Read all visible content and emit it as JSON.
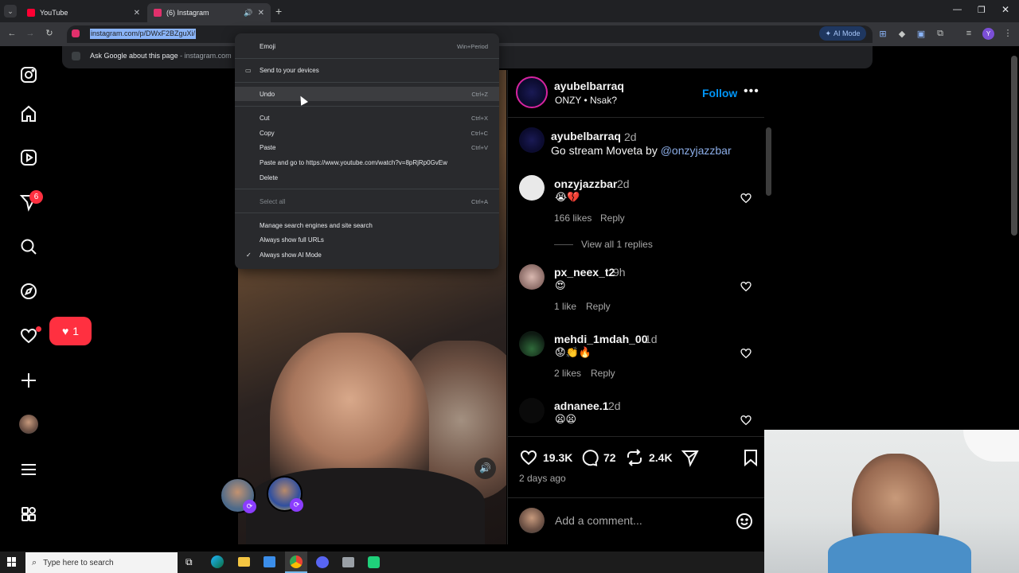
{
  "tabs": [
    {
      "title": "YouTube",
      "favicon_color": "#ff0033"
    },
    {
      "title": "(6) Instagram",
      "favicon_color": "#e1306c"
    }
  ],
  "omnibox": {
    "url": "instagram.com/p/DWxF2BZguXi/",
    "suggestion_text": "Ask Google about this page",
    "suggestion_domain": "- instagram.com"
  },
  "toolbar": {
    "ai_mode_label": "AI Mode",
    "profile_letter": "Y"
  },
  "context_menu": {
    "items": [
      {
        "label": "Emoji",
        "shortcut": "Win+Period"
      },
      {
        "label": "Send to your devices",
        "shortcut": ""
      },
      {
        "label": "Undo",
        "shortcut": "Ctrl+Z"
      },
      {
        "label": "Cut",
        "shortcut": "Ctrl+X"
      },
      {
        "label": "Copy",
        "shortcut": "Ctrl+C"
      },
      {
        "label": "Paste",
        "shortcut": "Ctrl+V"
      },
      {
        "label": "Paste and go to https://www.youtube.com/watch?v=8pRjRp0GvEw",
        "shortcut": ""
      },
      {
        "label": "Delete",
        "shortcut": ""
      },
      {
        "label": "Select all",
        "shortcut": "Ctrl+A"
      },
      {
        "label": "Manage search engines and site search",
        "shortcut": ""
      },
      {
        "label": "Always show full URLs",
        "shortcut": ""
      },
      {
        "label": "Always show AI Mode",
        "shortcut": ""
      }
    ],
    "checkmark": "✓"
  },
  "sidebar": {
    "notification_badge": "6",
    "likes_popup_count": "1"
  },
  "post": {
    "author": "ayubelbarraq",
    "subtitle": "ONZY • Nsak?",
    "follow_label": "Follow",
    "caption_user": "ayubelbarraq",
    "caption_time": "2d",
    "caption_text": "Go stream Moveta by ",
    "caption_mention": "@onzyjazzbar",
    "likes": "19.3K",
    "comments_count": "72",
    "reposts": "2.4K",
    "posted_ago": "2 days ago",
    "add_comment_placeholder": "Add a comment..."
  },
  "comments": [
    {
      "user": "onzyjazzbar",
      "time": "2d",
      "text": "😭💔",
      "likes": "166 likes",
      "reply": "Reply",
      "view_replies": "View all 1 replies"
    },
    {
      "user": "px_neex_t2",
      "time": "9h",
      "text": "😍",
      "likes": "1 like",
      "reply": "Reply"
    },
    {
      "user": "mehdi_1mdah_00",
      "time": "1d",
      "text": "😟👏🔥",
      "likes": "2 likes",
      "reply": "Reply"
    },
    {
      "user": "adnanee.1",
      "time": "2d",
      "text": "😦😦",
      "likes": "",
      "reply": ""
    }
  ],
  "taskbar": {
    "search_placeholder": "Type here to search"
  },
  "colors": {
    "accent_blue": "#0095f6",
    "notif_red": "#ff3040",
    "menu_bg": "#292a2d"
  }
}
